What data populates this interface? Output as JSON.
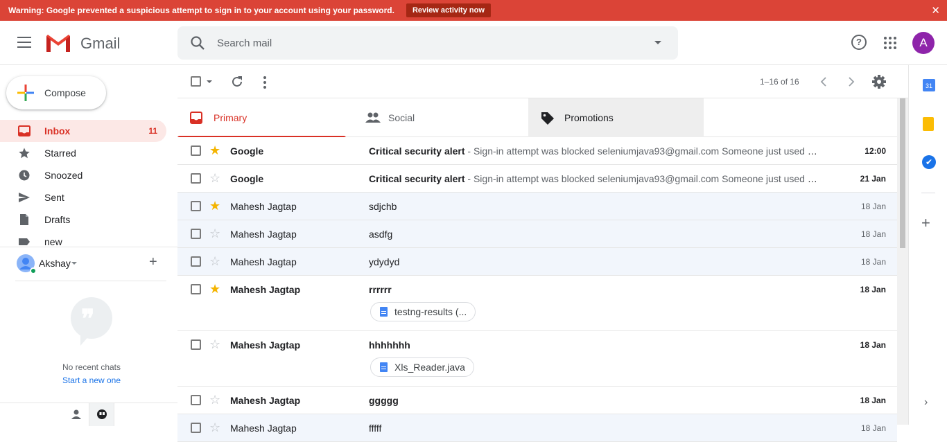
{
  "banner": {
    "message": "Warning: Google prevented a suspicious attempt to sign in to your account using your password.",
    "review_label": "Review activity now",
    "close_glyph": "✕",
    "color": "#db4437"
  },
  "header": {
    "brand": "Gmail",
    "search_placeholder": "Search mail",
    "help_glyph": "?",
    "avatar_letter": "A",
    "avatar_color": "#8e24aa"
  },
  "sidebar": {
    "compose_label": "Compose",
    "items": [
      {
        "label": "Inbox",
        "count": "11",
        "icon": "inbox-icon",
        "active": true
      },
      {
        "label": "Starred",
        "count": "",
        "icon": "star-icon"
      },
      {
        "label": "Snoozed",
        "count": "",
        "icon": "clock-icon"
      },
      {
        "label": "Sent",
        "count": "",
        "icon": "send-icon"
      },
      {
        "label": "Drafts",
        "count": "",
        "icon": "draft-icon"
      },
      {
        "label": "new",
        "count": "",
        "icon": "label-icon"
      }
    ]
  },
  "hangouts": {
    "user_name": "Akshay",
    "add_glyph": "+",
    "quote_glyph": "❞",
    "no_recent": "No recent chats",
    "start_new": "Start a new one"
  },
  "toolbar": {
    "range": "1–16 of 16"
  },
  "tabs": [
    {
      "label": "Primary",
      "icon": "inbox-icon",
      "active": true
    },
    {
      "label": "Social",
      "icon": "people-icon"
    },
    {
      "label": "Promotions",
      "icon": "tag-icon"
    }
  ],
  "mails": [
    {
      "sender": "Google",
      "subject": "Critical security alert",
      "snippet": " - Sign-in attempt was blocked seleniumjava93@gmail.com Someone just used your password to try to sign in to your account",
      "date": "12:00",
      "unread": true,
      "starred": true,
      "attachment": ""
    },
    {
      "sender": "Google",
      "subject": "Critical security alert",
      "snippet": " - Sign-in attempt was blocked seleniumjava93@gmail.com Someone just used your password to try to sign in to your account",
      "date": "21 Jan",
      "unread": true,
      "starred": false,
      "attachment": ""
    },
    {
      "sender": "Mahesh Jagtap",
      "subject": "sdjchb",
      "snippet": "",
      "date": "18 Jan",
      "unread": false,
      "starred": true,
      "attachment": ""
    },
    {
      "sender": "Mahesh Jagtap",
      "subject": "asdfg",
      "snippet": "",
      "date": "18 Jan",
      "unread": false,
      "starred": false,
      "attachment": ""
    },
    {
      "sender": "Mahesh Jagtap",
      "subject": "ydydyd",
      "snippet": "",
      "date": "18 Jan",
      "unread": false,
      "starred": false,
      "attachment": ""
    },
    {
      "sender": "Mahesh Jagtap",
      "subject": "rrrrrr",
      "snippet": "",
      "date": "18 Jan",
      "unread": true,
      "starred": true,
      "attachment": "testng-results (..."
    },
    {
      "sender": "Mahesh Jagtap",
      "subject": "hhhhhhh",
      "snippet": "",
      "date": "18 Jan",
      "unread": true,
      "starred": false,
      "attachment": "Xls_Reader.java"
    },
    {
      "sender": "Mahesh Jagtap",
      "subject": "ggggg",
      "snippet": "",
      "date": "18 Jan",
      "unread": true,
      "starred": false,
      "attachment": ""
    },
    {
      "sender": "Mahesh Jagtap",
      "subject": "fffff",
      "snippet": "",
      "date": "18 Jan",
      "unread": false,
      "starred": false,
      "attachment": ""
    }
  ],
  "side_panel": {
    "calendar_glyph": "31",
    "tasks_glyph": "✔",
    "add_glyph": "+",
    "expand_glyph": "›"
  },
  "colors": {
    "accent_red": "#d93025",
    "star_yellow": "#f4b400",
    "link_blue": "#1a73e8"
  }
}
